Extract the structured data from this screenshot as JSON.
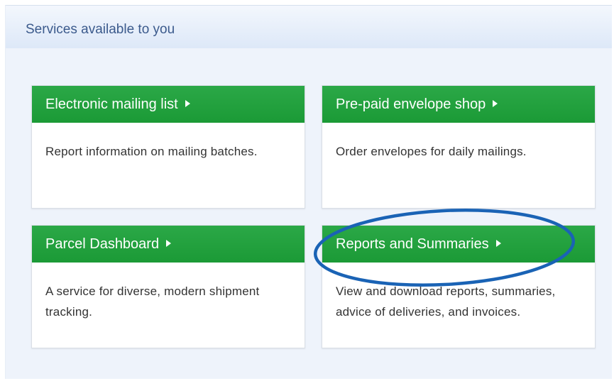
{
  "panel": {
    "title": "Services available to you"
  },
  "cards": [
    {
      "title": "Electronic mailing list",
      "description": "Report information on mailing batches."
    },
    {
      "title": "Pre-paid envelope shop",
      "description": "Order envelopes for daily mailings."
    },
    {
      "title": "Parcel Dashboard",
      "description": "A service for diverse, modern shipment tracking."
    },
    {
      "title": "Reports and Summaries",
      "description": "View and download reports, summaries, advice of deliveries, and invoices."
    }
  ],
  "colors": {
    "accent_green": "#1fa23b",
    "header_text_blue": "#3b5a8c",
    "annotation_circle": "#1a63b5"
  },
  "icons": {
    "card_link_arrow": "caret-right-icon"
  }
}
